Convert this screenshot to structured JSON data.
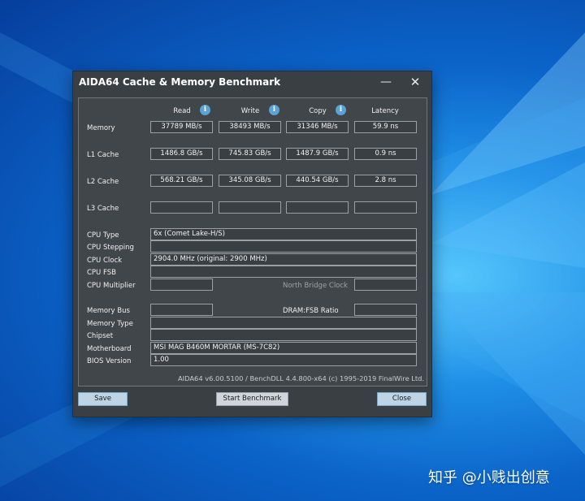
{
  "window": {
    "title": "AIDA64 Cache & Memory Benchmark",
    "minimize_glyph": "—",
    "close_glyph": "✕"
  },
  "columns": {
    "read": "Read",
    "write": "Write",
    "copy": "Copy",
    "latency": "Latency",
    "info_glyph": "i"
  },
  "rows": {
    "memory": {
      "label": "Memory",
      "read": "37789 MB/s",
      "write": "38493 MB/s",
      "copy": "31346 MB/s",
      "latency": "59.9 ns"
    },
    "l1": {
      "label": "L1 Cache",
      "read": "1486.8 GB/s",
      "write": "745.83 GB/s",
      "copy": "1487.9 GB/s",
      "latency": "0.9 ns"
    },
    "l2": {
      "label": "L2 Cache",
      "read": "568.21 GB/s",
      "write": "345.08 GB/s",
      "copy": "440.54 GB/s",
      "latency": "2.8 ns"
    },
    "l3": {
      "label": "L3 Cache",
      "read": "",
      "write": "",
      "copy": "",
      "latency": ""
    }
  },
  "cpu": {
    "type_label": "CPU Type",
    "type_value": "6x   (Comet Lake-H/S)",
    "stepping_label": "CPU Stepping",
    "stepping_value": "",
    "clock_label": "CPU Clock",
    "clock_value": "2904.0 MHz  (original: 2900 MHz)",
    "fsb_label": "CPU FSB",
    "fsb_value": "",
    "multiplier_label": "CPU Multiplier",
    "multiplier_value": "",
    "nb_clock_label": "North Bridge Clock",
    "nb_clock_value": ""
  },
  "memory_info": {
    "bus_label": "Memory Bus",
    "bus_value": "",
    "ratio_label": "DRAM:FSB Ratio",
    "ratio_value": "",
    "type_label": "Memory Type",
    "type_value": "",
    "chipset_label": "Chipset",
    "chipset_value": "",
    "motherboard_label": "Motherboard",
    "motherboard_value": "MSI MAG B460M MORTAR (MS-7C82)",
    "bios_label": "BIOS Version",
    "bios_value": "1.00"
  },
  "footer": "AIDA64 v6.00.5100 / BenchDLL 4.4.800-x64  (c) 1995-2019 FinalWire Ltd.",
  "buttons": {
    "save": "Save",
    "start": "Start Benchmark",
    "close": "Close"
  },
  "watermark": "知乎 @小贱出创意",
  "colors": {
    "window_bg": "#3a3f44",
    "accent_info": "#5aa3d6",
    "desktop": "#0b63c8"
  },
  "icons": {
    "info": "info-icon",
    "close": "close-icon",
    "minimize": "minimize-icon"
  }
}
